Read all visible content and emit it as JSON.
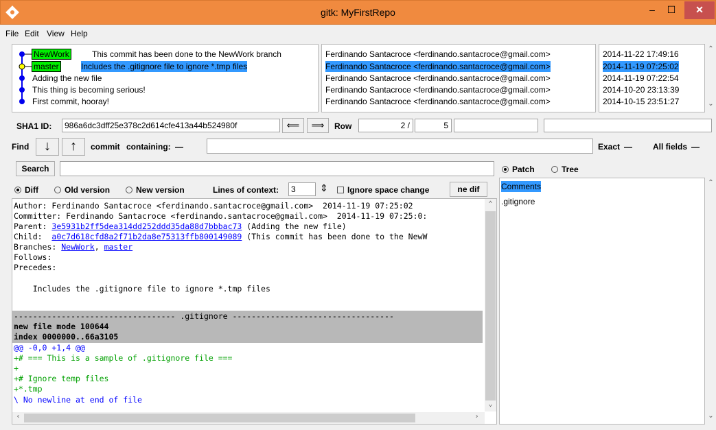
{
  "window": {
    "title": "gitk: MyFirstRepo",
    "min_glyph": "–",
    "max_glyph": "☐",
    "close_glyph": "✕"
  },
  "menu": {
    "file": "File",
    "edit": "Edit",
    "view": "View",
    "help": "Help"
  },
  "branches": {
    "newwork": "NewWork",
    "master": "master"
  },
  "commits": [
    {
      "message": "This commit has been done to the NewWork branch",
      "author": "Ferdinando Santacroce <ferdinando.santacroce@gmail.com>",
      "date": "2014-11-22 17:49:16"
    },
    {
      "message": "Includes the .gitignore file to ignore *.tmp files",
      "author": "Ferdinando Santacroce <ferdinando.santacroce@gmail.com>",
      "date": "2014-11-19 07:25:02"
    },
    {
      "message": "Adding the new file",
      "author": "Ferdinando Santacroce <ferdinando.santacroce@gmail.com>",
      "date": "2014-11-19 07:22:54"
    },
    {
      "message": "This thing is becoming serious!",
      "author": "Ferdinando Santacroce <ferdinando.santacroce@gmail.com>",
      "date": "2014-10-20 23:13:39"
    },
    {
      "message": "First commit, hooray!",
      "author": "Ferdinando Santacroce <ferdinando.santacroce@gmail.com>",
      "date": "2014-10-15 23:51:27"
    }
  ],
  "sha": {
    "label": "SHA1 ID:",
    "value": "986a6dc3dff25e378c2d614cfe413a44b524980f",
    "back": "⟸",
    "fwd": "⟹"
  },
  "row": {
    "label": "Row",
    "current": "2 /",
    "total": "5"
  },
  "find": {
    "label": "Find",
    "down": "↓",
    "up": "↑",
    "type": "commit",
    "mode": "containing:",
    "exact": "Exact",
    "fields": "All fields"
  },
  "search": {
    "button": "Search",
    "patch": "Patch",
    "tree": "Tree"
  },
  "diffopts": {
    "diff": "Diff",
    "old": "Old version",
    "new": "New version",
    "context_label": "Lines of context:",
    "context_value": "3",
    "ignore_space": "Ignore space change",
    "line_diff": "ne dif"
  },
  "details": {
    "author": "Author: Ferdinando Santacroce <ferdinando.santacroce@gmail.com>  2014-11-19 07:25:02",
    "committer": "Committer: Ferdinando Santacroce <ferdinando.santacroce@gmail.com>  2014-11-19 07:25:0:",
    "parent_label": "Parent: ",
    "parent_hash": "3e5931b2ff5dea314dd252ddd35da88d7bbbac73",
    "parent_msg": " (Adding the new file)",
    "child_label": "Child:  ",
    "child_hash": "a0c7d618cfd8a2f71b2da8e75313ffb800149089",
    "child_msg": " (This commit has been done to the NewW",
    "branches_label": "Branches: ",
    "branch1": "NewWork",
    "branch_sep": ", ",
    "branch2": "master",
    "follows": "Follows:",
    "precedes": "Precedes:",
    "message": "    Includes the .gitignore file to ignore *.tmp files"
  },
  "diff": {
    "file_header": "---------------------------------- .gitignore ----------------------------------",
    "mode": "new file mode 100644",
    "index": "index 0000000..66a3105",
    "hunk": "@@ -0,0 +1,4 @@",
    "add1": "+# === This is a sample of .gitignore file ===",
    "add2": "+",
    "add3": "+# Ignore temp files",
    "add4": "+*.tmp",
    "nonl": "\\ No newline at end of file"
  },
  "files": {
    "comments": "Comments",
    "gitignore": ".gitignore"
  }
}
